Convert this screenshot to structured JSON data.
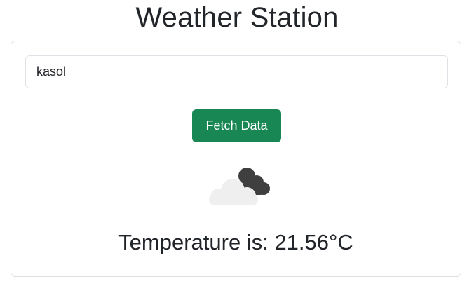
{
  "header": {
    "title": "Weather Station"
  },
  "search": {
    "value": "kasol"
  },
  "actions": {
    "fetch_label": "Fetch Data"
  },
  "weather": {
    "icon": "broken-clouds-icon",
    "temperature_prefix": "Temperature is: ",
    "temperature_value": "21.56",
    "temperature_unit": "°C"
  },
  "colors": {
    "accent": "#198754",
    "text": "#212529",
    "border": "#dee2e6"
  }
}
